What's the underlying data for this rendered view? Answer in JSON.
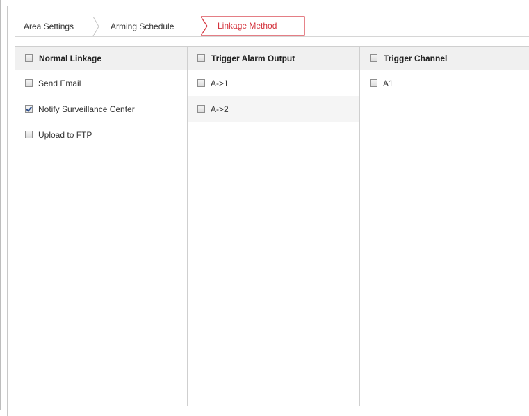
{
  "tabs": [
    {
      "label": "Area Settings",
      "active": false
    },
    {
      "label": "Arming Schedule",
      "active": false
    },
    {
      "label": "Linkage Method",
      "active": true
    }
  ],
  "accent_color": "#d4323c",
  "columns": [
    {
      "header": "Normal Linkage",
      "header_checked": false,
      "items": [
        {
          "label": "Send Email",
          "checked": false
        },
        {
          "label": "Notify Surveillance Center",
          "checked": true
        },
        {
          "label": "Upload to FTP",
          "checked": false
        }
      ]
    },
    {
      "header": "Trigger Alarm Output",
      "header_checked": false,
      "items": [
        {
          "label": "A->1",
          "checked": false
        },
        {
          "label": "A->2",
          "checked": false
        }
      ]
    },
    {
      "header": "Trigger Channel",
      "header_checked": false,
      "items": [
        {
          "label": "A1",
          "checked": false
        }
      ]
    }
  ]
}
